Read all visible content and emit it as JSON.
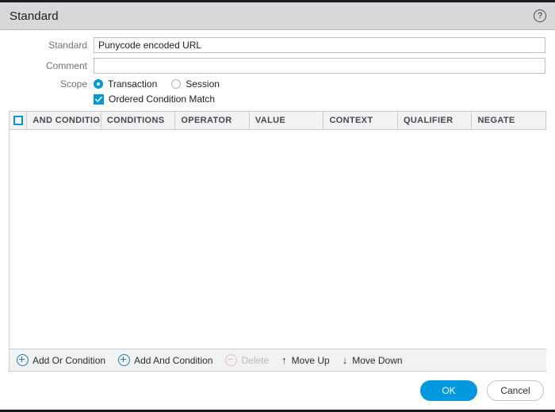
{
  "window": {
    "title": "Standard",
    "help_icon": "question-mark-circle-icon"
  },
  "form": {
    "standard": {
      "label": "Standard",
      "value": "Punycode encoded URL",
      "placeholder": ""
    },
    "comment": {
      "label": "Comment",
      "value": "",
      "placeholder": ""
    },
    "scope": {
      "label": "Scope",
      "options": [
        {
          "label": "Transaction",
          "selected": true
        },
        {
          "label": "Session",
          "selected": false
        }
      ]
    },
    "ordered_condition_match": {
      "label": "Ordered Condition Match",
      "checked": true
    }
  },
  "table": {
    "select_all_checked": false,
    "columns": [
      "AND CONDITION",
      "CONDITIONS",
      "OPERATOR",
      "VALUE",
      "CONTEXT",
      "QUALIFIER",
      "NEGATE"
    ],
    "rows": []
  },
  "toolbar": {
    "add_or_condition": "Add Or Condition",
    "add_and_condition": "Add And Condition",
    "delete": "Delete",
    "move_up": "Move Up",
    "move_down": "Move Down",
    "move_up_icon": "arrow-up-icon",
    "move_down_icon": "arrow-down-icon",
    "delete_enabled": false
  },
  "footer": {
    "ok": "OK",
    "cancel": "Cancel"
  },
  "colors": {
    "accent": "#0099d8",
    "primary_button": "#0099e0",
    "titlebar": "#d7d8da",
    "table_header": "#f1f2f3",
    "label_text": "#6f7277"
  }
}
